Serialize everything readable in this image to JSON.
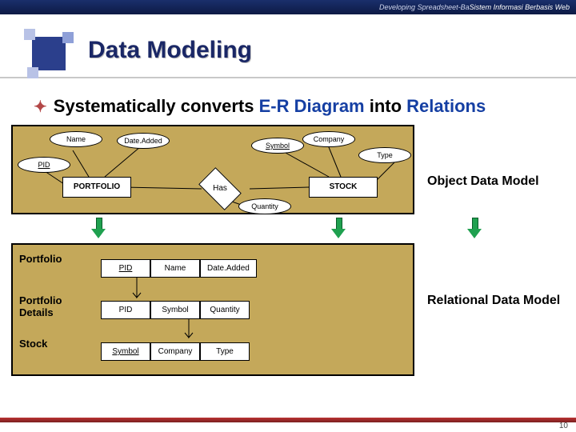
{
  "header": {
    "ghost_text": "Developing Spreadsheet-Ba",
    "credit": "Sistem Informasi Berbasis Web"
  },
  "title": "Data Modeling",
  "bullet": {
    "pre": "Systematically converts ",
    "er": "E-R Diagram",
    "mid": " into ",
    "rel": "Relations"
  },
  "er": {
    "entity_portfolio": "PORTFOLIO",
    "entity_stock": "STOCK",
    "relationship": "Has",
    "attrs": {
      "name": "Name",
      "date_added": "Date.Added",
      "pid": "PID",
      "company": "Company",
      "symbol": "Symbol",
      "type": "Type",
      "quantity": "Quantity"
    },
    "label": "Object Data Model"
  },
  "relational": {
    "tables": {
      "portfolio": {
        "label": "Portfolio",
        "cols": [
          "PID",
          "Name",
          "Date.Added"
        ]
      },
      "portfolio_details": {
        "label": "Portfolio\nDetails",
        "cols": [
          "PID",
          "Symbol",
          "Quantity"
        ]
      },
      "stock": {
        "label": "Stock",
        "cols": [
          "Symbol",
          "Company",
          "Type"
        ]
      }
    },
    "label": "Relational Data Model"
  },
  "page_number": "10"
}
